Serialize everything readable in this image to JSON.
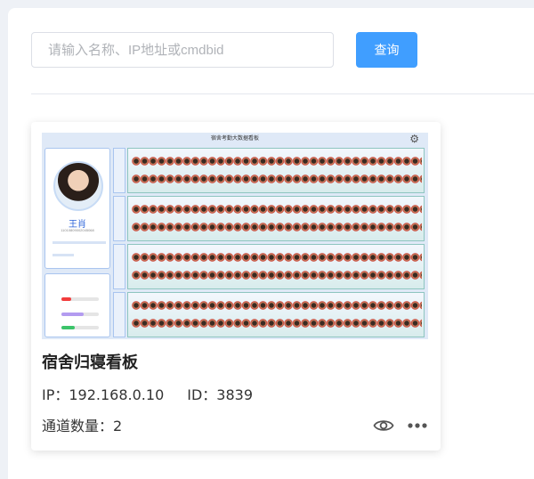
{
  "search": {
    "placeholder": "请输入名称、IP地址或cmdbid",
    "value": "",
    "button_label": "查询"
  },
  "device_card": {
    "thumbnail": {
      "header_title": "宿舍考勤大数据看板",
      "person_name": "王肖",
      "person_id": "11010809002045068"
    },
    "title": "宿舍归寝看板",
    "ip_label": "IP：",
    "ip_value": "192.168.0.10",
    "id_label": "ID：",
    "id_value": "3839",
    "channel_label": "通道数量：",
    "channel_value": "2",
    "icons": {
      "preview": "eye-icon",
      "more": "more-icon"
    }
  },
  "colors": {
    "primary": "#409eff",
    "card_title": "#222222",
    "name_blue": "#2b63d9"
  }
}
